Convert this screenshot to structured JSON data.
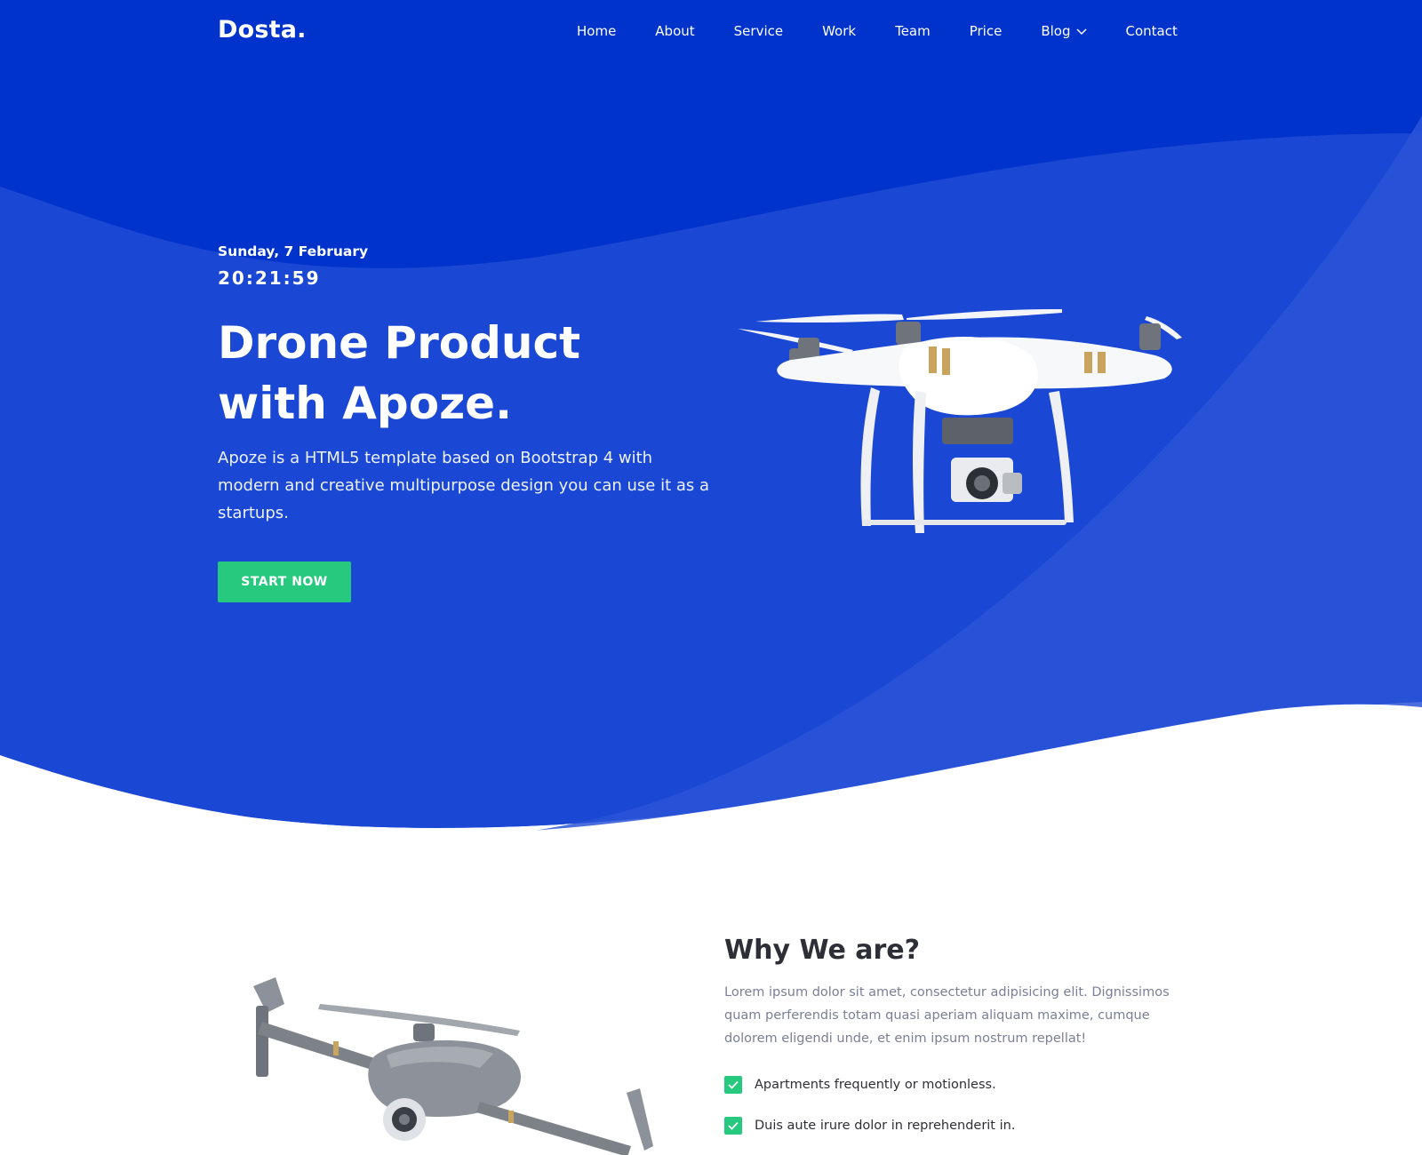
{
  "header": {
    "logo": "Dosta.",
    "nav": [
      {
        "label": "Home"
      },
      {
        "label": "About"
      },
      {
        "label": "Service"
      },
      {
        "label": "Work"
      },
      {
        "label": "Team"
      },
      {
        "label": "Price"
      },
      {
        "label": "Blog"
      },
      {
        "label": "Contact"
      }
    ]
  },
  "hero": {
    "date": "Sunday, 7 February",
    "time": "20:21:59",
    "title_line1": "Drone Product",
    "title_line2": "with Apoze.",
    "description": "Apoze is a HTML5 template based on Bootstrap 4 with modern and creative multipurpose design you can use it as a startups.",
    "cta_label": "START NOW"
  },
  "why": {
    "title": "Why We are?",
    "description": "Lorem ipsum dolor sit amet, consectetur adipisicing elit. Dignissimos quam perferendis totam quasi aperiam aliquam maxime, cumque dolorem eligendi unde, et enim ipsum nostrum repellat!",
    "checklist": [
      {
        "text": "Apartments frequently or motionless."
      },
      {
        "text": "Duis aute irure dolor in reprehenderit in."
      }
    ]
  },
  "colors": {
    "hero_dark": "#0033cc",
    "hero_mid": "#1a47d4",
    "hero_light": "#2a55d8",
    "accent_green": "#26c97d",
    "heading_dark": "#2e2e36",
    "body_muted": "#7a7f96"
  }
}
